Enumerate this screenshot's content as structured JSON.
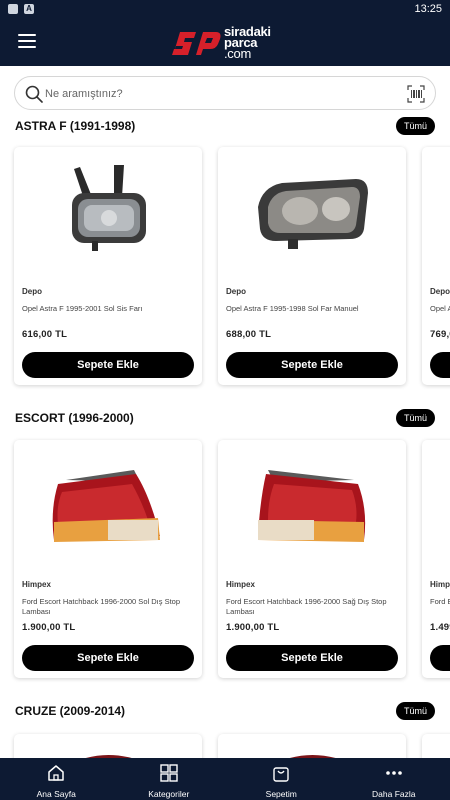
{
  "status": {
    "time": "13:25"
  },
  "header": {
    "logo_line1": "siradaki",
    "logo_line2": "parca",
    "logo_line3": ".com"
  },
  "search": {
    "placeholder": "Ne aramıştınız?"
  },
  "sections": [
    {
      "title": "ASTRA F (1991-1998)",
      "all_label": "Tümü",
      "products": [
        {
          "brand": "Depo",
          "name": "Opel Astra F 1995-2001 Sol Sis Farı",
          "price": "616,00 TL",
          "button": "Sepete Ekle"
        },
        {
          "brand": "Depo",
          "name": "Opel Astra F 1995-1998 Sol Far Manuel",
          "price": "688,00 TL",
          "button": "Sepete Ekle"
        },
        {
          "brand": "Depo",
          "name": "Opel A",
          "price": "769,0",
          "button": ""
        }
      ]
    },
    {
      "title": "ESCORT (1996-2000)",
      "all_label": "Tümü",
      "products": [
        {
          "brand": "Himpex",
          "name": "Ford Escort Hatchback 1996-2000 Sol Dış Stop Lambası",
          "price": "1.900,00 TL",
          "button": "Sepete Ekle"
        },
        {
          "brand": "Himpex",
          "name": "Ford Escort Hatchback 1996-2000 Sağ Dış Stop Lambası",
          "price": "1.900,00 TL",
          "button": "Sepete Ekle"
        },
        {
          "brand": "Himp",
          "name": "Ford E",
          "price": "1.499",
          "button": ""
        }
      ]
    },
    {
      "title": "CRUZE (2009-2014)",
      "all_label": "Tümü",
      "products": []
    }
  ],
  "bottom_nav": [
    {
      "label": "Ana Sayfa",
      "icon": "home-icon"
    },
    {
      "label": "Kategoriler",
      "icon": "grid-icon"
    },
    {
      "label": "Sepetim",
      "icon": "cart-icon"
    },
    {
      "label": "Daha Fazla",
      "icon": "more-icon"
    }
  ],
  "colors": {
    "navy": "#0d1a33",
    "brand_red": "#d6202a",
    "button": "#000000"
  }
}
